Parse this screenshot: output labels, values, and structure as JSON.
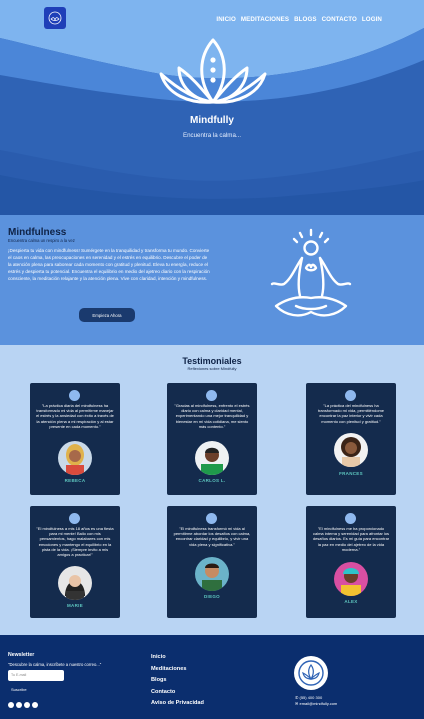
{
  "nav": {
    "items": [
      "INICIO",
      "MEDITACIONES",
      "BLOGS",
      "CONTACTO",
      "LOGIN"
    ]
  },
  "hero": {
    "title": "Mindfully",
    "subtitle": "Encuentra la calma..."
  },
  "about": {
    "title": "Mindfulness",
    "tagline": "Encuentra calma un respiro a la vez",
    "body": "¡Despierta tu vida con mindfulness! Sumérgete en la tranquilidad y transforma tu mundo. Convierte el caos en calma, las preocupaciones en serenidad y el estrés en equilibrio. Descubre el poder de la atención plena para saborear cada momento con gratitud y plenitud. Eleva tu energía, reduce el estrés y despierta tu potencial. Encuentra el equilibrio en medio del ajetreo diario con la respiración consciente, la meditación relajante y la atención plena. Vive con claridad, intención y mindfulness.",
    "button": "Empieza Ahora"
  },
  "testimonials": {
    "title": "Testimoniales",
    "subtitle": "Reflexiones sobre Mindfully",
    "items": [
      {
        "quote": "\"La práctica diaria del mindfulness ha transformado mi vida al permitirme manejar el estrés y la ansiedad con éxito a través de la atención plena a mi respiración y al estar presente en cada momento.\"",
        "name": "REBECA"
      },
      {
        "quote": "\"Gracias al mindfulness, enfrento el estrés diario con calma y claridad mental, experimentando una mejor tranquilidad y bienestar en mi vida cotidiana, me siento más contento.\"",
        "name": "CARLOS L."
      },
      {
        "quote": "\"La práctica del mindfulness ha transformado mi vida, permitiéndome encontrar la paz interior y vivir cada momento con plenitud y gratitud.\"",
        "name": "FRANCES"
      },
      {
        "quote": "\"El mindfulness a mis 18 años es una fiesta para mi mente! Bailo con mis pensamientos, hago malabares con mis emociones y mantengo el equilibrio en la pista de la vida. ¡Siempre invito a mis amigos a practicar!\"",
        "name": "MARIE"
      },
      {
        "quote": "\"El mindfulness transformó mi vida al permitirme abordar los desafíos con calma, encontrar claridad y equilibrio, y vivir una vida plena y significativa.\"",
        "name": "DIEGO"
      },
      {
        "quote": "\"El mindfulness me ha proporcionado calma interna y serenidad para afrontar los desafíos diarios. Es mi guía para encontrar la paz en medio del ajetreo de la vida moderna.\"",
        "name": "ALEX"
      }
    ]
  },
  "footer": {
    "newsletter_title": "Newsletter",
    "newsletter_text": "\"Descubre la calma, inscríbete a nuestro correo...\"",
    "email_placeholder": "Tu E-mail",
    "subscribe": "Suscribe",
    "links": [
      "Inicio",
      "Meditaciones",
      "Blogs",
      "Contacto",
      "Aviso de Privacidad"
    ],
    "phone": "(55) 400 300",
    "email": "email@mindfully.com"
  },
  "colors": {
    "hero_bg": "#2f63b5",
    "about_bg": "#5b92dd",
    "testimonials_bg": "#b9d4f3",
    "card_bg": "#142b4d",
    "footer_bg": "#0b2e6e",
    "accent_name": "#5ec7c0"
  },
  "icons": {
    "logo": "lotus-icon",
    "meditator": "meditating-person-icon",
    "quote_badge": "quote-icon",
    "social": [
      "facebook-icon",
      "instagram-icon",
      "youtube-icon",
      "whatsapp-icon"
    ],
    "phone": "phone-icon",
    "email": "email-icon"
  }
}
